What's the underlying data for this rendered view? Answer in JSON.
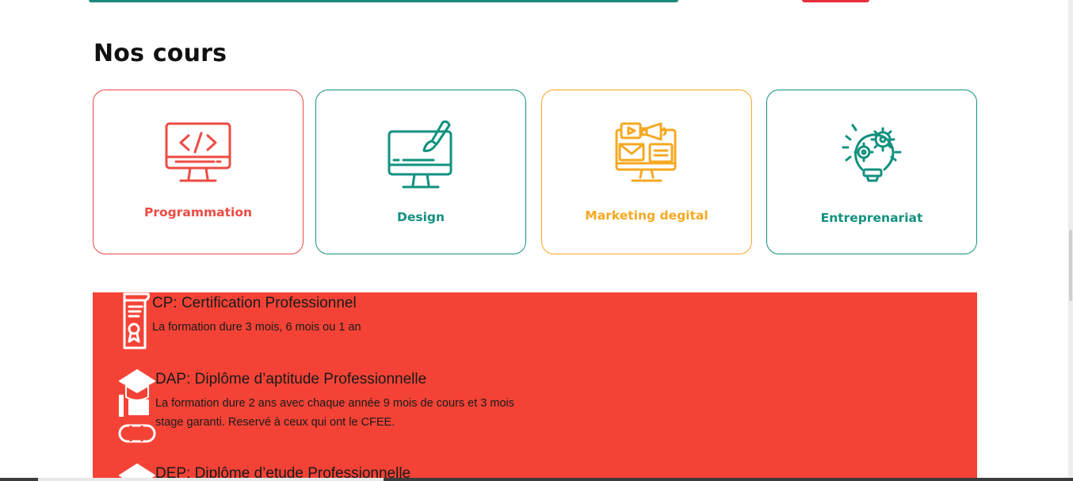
{
  "section": {
    "title": "Nos cours"
  },
  "courses": [
    {
      "label": "Programmation",
      "icon": "code-monitor-icon",
      "color": "#ec4b44"
    },
    {
      "label": "Design",
      "icon": "design-monitor-icon",
      "color": "#12917f"
    },
    {
      "label": "Marketing degital",
      "icon": "marketing-icon",
      "color": "#f6a821"
    },
    {
      "label": "Entreprenariat",
      "icon": "lightbulb-gears-icon",
      "color": "#12917f"
    }
  ],
  "diplomas": [
    {
      "title": "CP: Certification Professionnel",
      "desc": "La formation dure 3 mois, 6 mois ou 1 an",
      "icon": "certificate-scroll-icon"
    },
    {
      "title": "DAP: Diplôme d’aptitude Professionnelle",
      "desc": "La formation dure 2 ans avec chaque année 9 mois de cours et 3 mois stage garanti. Reservé à ceux qui ont le CFEE.",
      "icon": "graduation-diploma-icon"
    },
    {
      "title": "DEP: Diplôme d’etude Professionnelle",
      "icon": "graduation-cap-icon"
    }
  ],
  "colors": {
    "panel_bg": "#f44336",
    "accent_red": "#ec4b44",
    "accent_teal": "#12917f",
    "accent_orange": "#f6a821"
  }
}
